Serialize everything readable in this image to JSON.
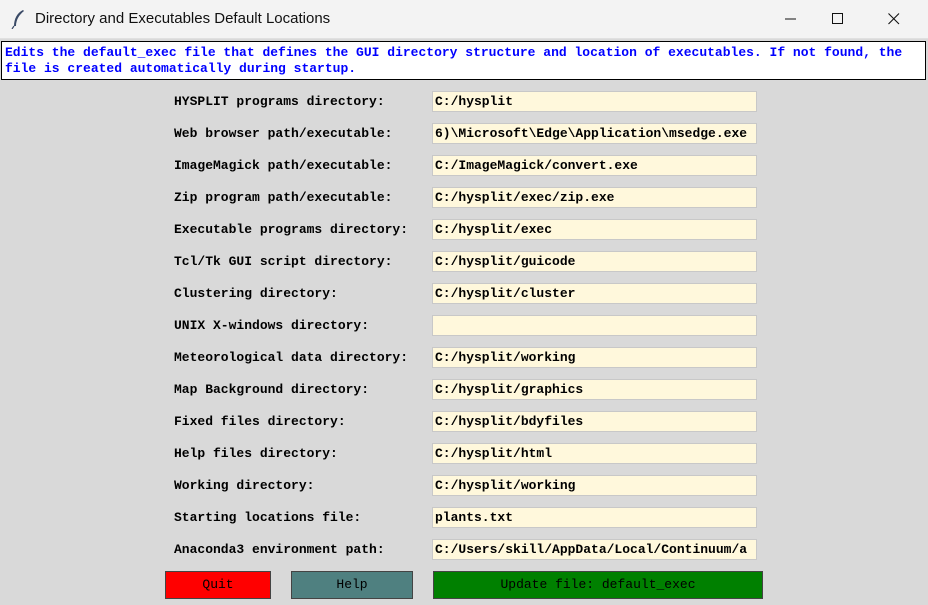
{
  "window": {
    "title": "Directory and Executables Default Locations"
  },
  "description": "Edits the default_exec file that defines the GUI directory structure and location of executables. If not found, the file is created automatically during startup.",
  "fields": [
    {
      "label": "HYSPLIT programs directory:",
      "value": "C:/hysplit"
    },
    {
      "label": "Web browser path/executable:",
      "value": "6)\\Microsoft\\Edge\\Application\\msedge.exe"
    },
    {
      "label": "ImageMagick path/executable:",
      "value": "C:/ImageMagick/convert.exe"
    },
    {
      "label": "Zip program path/executable:",
      "value": "C:/hysplit/exec/zip.exe"
    },
    {
      "label": "Executable programs directory:",
      "value": "C:/hysplit/exec"
    },
    {
      "label": "Tcl/Tk GUI script directory:",
      "value": "C:/hysplit/guicode"
    },
    {
      "label": "Clustering directory:",
      "value": "C:/hysplit/cluster"
    },
    {
      "label": "UNIX X-windows directory:",
      "value": ""
    },
    {
      "label": "Meteorological data directory:",
      "value": "C:/hysplit/working"
    },
    {
      "label": "Map Background directory:",
      "value": "C:/hysplit/graphics"
    },
    {
      "label": "Fixed files directory:",
      "value": "C:/hysplit/bdyfiles"
    },
    {
      "label": "Help files directory:",
      "value": "C:/hysplit/html"
    },
    {
      "label": "Working directory:",
      "value": "C:/hysplit/working"
    },
    {
      "label": "Starting locations file:",
      "value": "plants.txt"
    },
    {
      "label": "Anaconda3 environment path:",
      "value": "C:/Users/skill/AppData/Local/Continuum/a"
    }
  ],
  "buttons": {
    "quit": "Quit",
    "help": "Help",
    "update": "Update file: default_exec"
  },
  "colors": {
    "description_text": "#0000ff",
    "input_background": "#fff8dc",
    "quit": "#ff0000",
    "help": "#4f8080",
    "update": "#008000",
    "window_background": "#d9d9d9"
  },
  "icons": {
    "app": "feather-icon",
    "minimize": "minimize-icon",
    "maximize": "maximize-icon",
    "close": "close-icon"
  }
}
